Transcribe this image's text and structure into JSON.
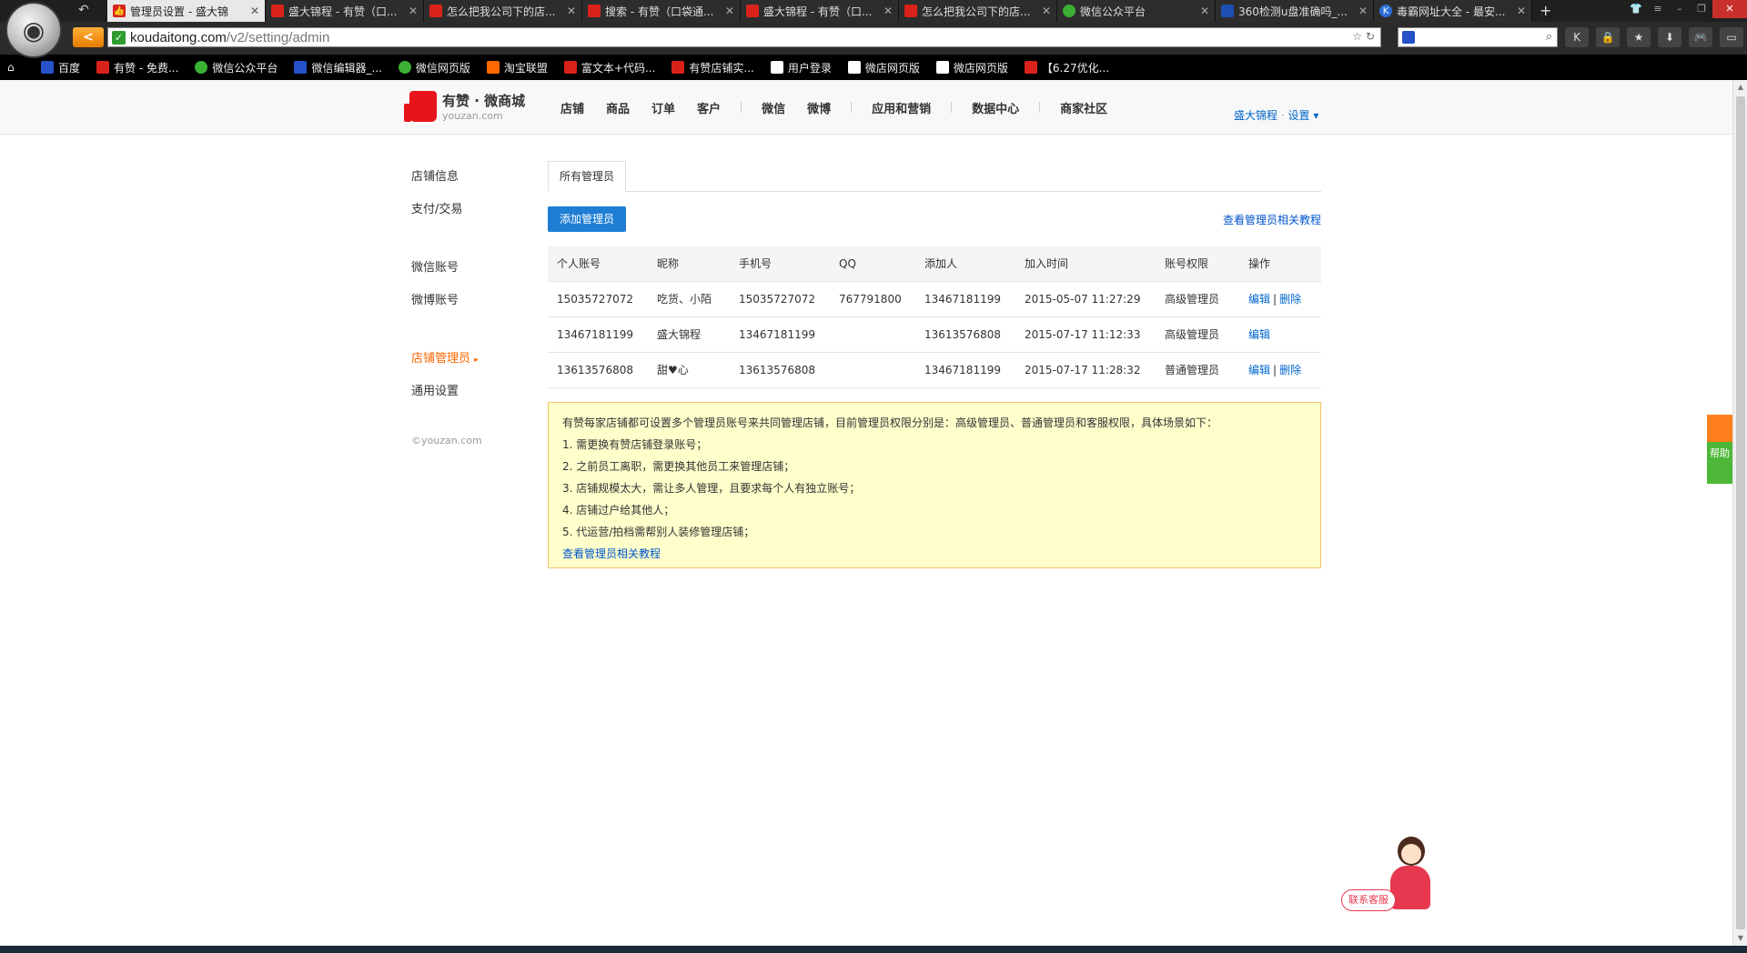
{
  "browser": {
    "tabs": [
      {
        "title": "管理员设置 - 盛大锦",
        "icon": "youzan-favicon",
        "active": true
      },
      {
        "title": "盛大锦程 - 有赞（口...",
        "icon": "youzan-favicon"
      },
      {
        "title": "怎么把我公司下的店...",
        "icon": "youzan-favicon"
      },
      {
        "title": "搜索 - 有赞（口袋通...",
        "icon": "youzan-favicon"
      },
      {
        "title": "盛大锦程 - 有赞（口...",
        "icon": "youzan-favicon"
      },
      {
        "title": "怎么把我公司下的店...",
        "icon": "youzan-favicon"
      },
      {
        "title": "微信公众平台",
        "icon": "wechat-favicon"
      },
      {
        "title": "360检测u盘准确吗_...",
        "icon": "baidu-favicon"
      },
      {
        "title": "毒霸网址大全 - 最安...",
        "icon": "kingsoft-favicon"
      }
    ],
    "url_host": "koudaitong.com",
    "url_path": "/v2/setting/admin",
    "bookmarks": [
      {
        "label": "百度",
        "icon": "baidu-icon"
      },
      {
        "label": "有赞 - 免费...",
        "icon": "youzan-icon"
      },
      {
        "label": "微信公众平台",
        "icon": "wechat-icon"
      },
      {
        "label": "微信编辑器_...",
        "icon": "editor-icon"
      },
      {
        "label": "微信网页版",
        "icon": "wechat-icon"
      },
      {
        "label": "淘宝联盟",
        "icon": "taobao-icon"
      },
      {
        "label": "富文本+代码...",
        "icon": "youzan-icon"
      },
      {
        "label": "有赞店铺实...",
        "icon": "youzan-icon"
      },
      {
        "label": "用户登录",
        "icon": "doc-icon"
      },
      {
        "label": "微店网页版",
        "icon": "doc-icon"
      },
      {
        "label": "微店网页版",
        "icon": "doc-icon"
      },
      {
        "label": "【6.27优化...",
        "icon": "youzan-icon"
      }
    ]
  },
  "header": {
    "logo_name": "有赞 · 微商城",
    "logo_sub": "youzan.com",
    "nav": [
      "店铺",
      "商品",
      "订单",
      "客户",
      "微信",
      "微博",
      "应用和营销",
      "数据中心",
      "商家社区"
    ],
    "user": "盛大锦程",
    "settings": "设置"
  },
  "sidebar": {
    "items": [
      "店铺信息",
      "支付/交易",
      "微信账号",
      "微博账号",
      "店铺管理员",
      "通用设置"
    ],
    "active": "店铺管理员",
    "copyright": "©youzan.com"
  },
  "content": {
    "tab": "所有管理员",
    "add_button": "添加管理员",
    "tutorial_link": "查看管理员相关教程",
    "table": {
      "headers": [
        "个人账号",
        "昵称",
        "手机号",
        "QQ",
        "添加人",
        "加入时间",
        "账号权限",
        "操作"
      ],
      "rows": [
        {
          "account": "15035727072",
          "nickname": "吃货、小陌",
          "phone": "15035727072",
          "qq": "767791800",
          "added_by": "13467181199",
          "joined": "2015-05-07 11:27:29",
          "role": "高级管理员",
          "edit": "编辑",
          "delete": "删除"
        },
        {
          "account": "13467181199",
          "nickname": "盛大锦程",
          "phone": "13467181199",
          "qq": "",
          "added_by": "13613576808",
          "joined": "2015-07-17 11:12:33",
          "role": "高级管理员",
          "edit": "编辑",
          "delete": ""
        },
        {
          "account": "13613576808",
          "nickname": "甜♥心",
          "phone": "13613576808",
          "qq": "",
          "added_by": "13467181199",
          "joined": "2015-07-17 11:28:32",
          "role": "普通管理员",
          "edit": "编辑",
          "delete": "删除"
        }
      ]
    },
    "notice": {
      "intro": "有赞每家店铺都可设置多个管理员账号来共同管理店铺，目前管理员权限分别是：高级管理员、普通管理员和客服权限，具体场景如下：",
      "items": [
        "1. 需更换有赞店铺登录账号；",
        "2. 之前员工离职，需更换其他员工来管理店铺；",
        "3. 店铺规模太大，需让多人管理，且要求每个人有独立账号；",
        "4. 店铺过户给其他人；",
        "5. 代运营/拍档需帮别人装修管理店铺；"
      ],
      "link": "查看管理员相关教程"
    }
  },
  "widgets": {
    "help": "帮助",
    "service": "联系客服"
  }
}
